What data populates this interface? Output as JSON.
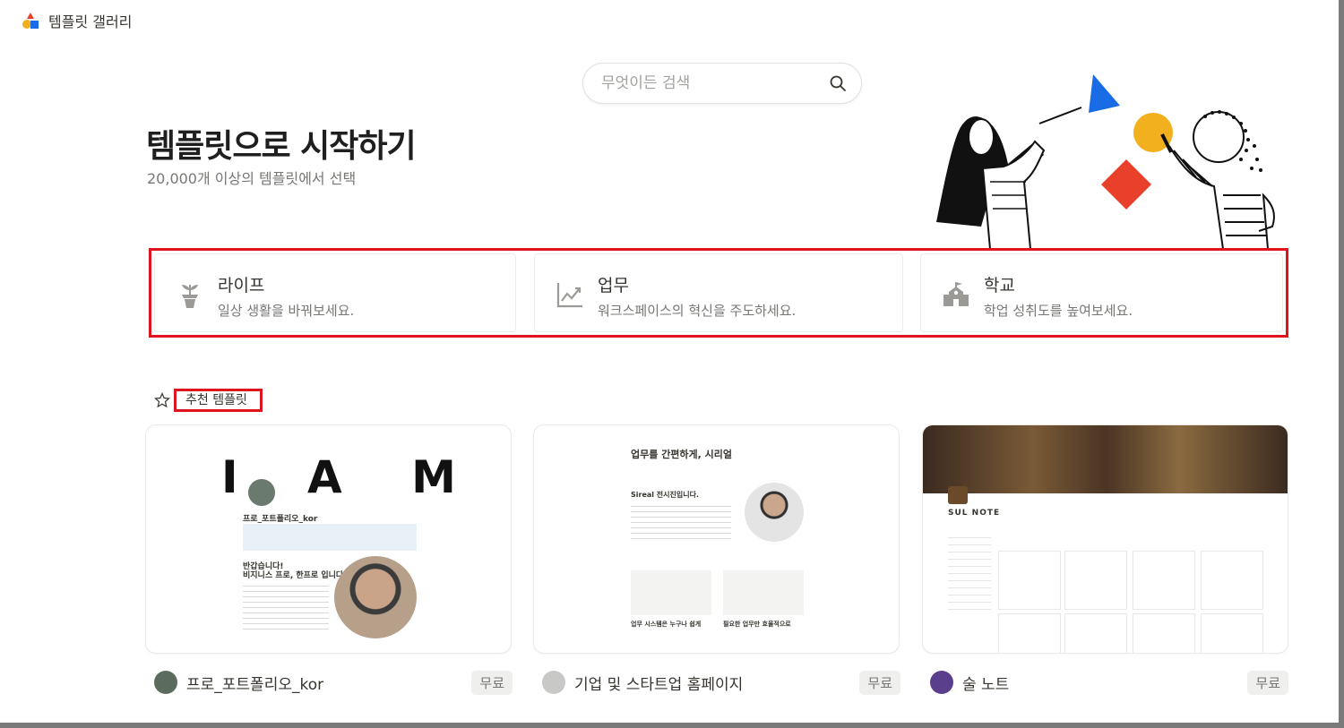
{
  "app": {
    "title": "템플릿 갤러리"
  },
  "search": {
    "placeholder": "무엇이든 검색"
  },
  "hero": {
    "title": "템플릿으로 시작하기",
    "subtitle": "20,000개 이상의 템플릿에서 선택"
  },
  "categories": [
    {
      "title": "라이프",
      "description": "일상 생활을 바꿔보세요.",
      "icon": "plant-icon"
    },
    {
      "title": "업무",
      "description": "워크스페이스의 혁신을 주도하세요.",
      "icon": "chart-icon"
    },
    {
      "title": "학교",
      "description": "학업 성취도를 높여보세요.",
      "icon": "school-icon"
    }
  ],
  "section": {
    "title": "추천 템플릿"
  },
  "templates": [
    {
      "name": "프로_포트폴리오_kor",
      "price": "무료",
      "preview": {
        "heading": "프로_포트폴리오_kor",
        "greeting": "반갑습니다!",
        "intro": "비지니스 프로, 한프로 입니다."
      }
    },
    {
      "name": "기업 및 스타트업 홈페이지",
      "price": "무료",
      "preview": {
        "heading": "업무를 간편하게, 시리얼",
        "sub": "Sireal 전시진입니다.",
        "feature1": "업무 시스템은 누구나 쉽게",
        "feature2": "필요한 업무만 효율적으로"
      }
    },
    {
      "name": "술 노트",
      "price": "무료",
      "preview": {
        "heading": "SUL NOTE"
      }
    }
  ],
  "colors": {
    "highlight": "#e0141f",
    "accent_blue": "#1a6ce6",
    "accent_yellow": "#f2b01e",
    "accent_red": "#e8402a"
  }
}
